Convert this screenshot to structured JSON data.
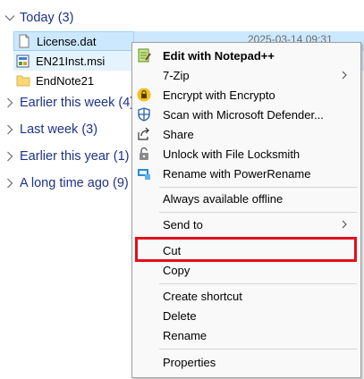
{
  "groups": {
    "today": "Today (3)",
    "earlier_this_week": "Earlier this week (4)",
    "last_week": "Last week (3)",
    "earlier_this_year": "Earlier this year (1)",
    "long_time_ago": "A long time ago (9)"
  },
  "files": [
    {
      "name": "License.dat",
      "icon": "document-icon"
    },
    {
      "name": "EN21Inst.msi",
      "icon": "installer-icon"
    },
    {
      "name": "EndNote21",
      "icon": "folder-icon"
    }
  ],
  "selected_date": "2025-03-14 09:31",
  "menu": {
    "edit_notepad": "Edit with Notepad++",
    "seven_zip": "7-Zip",
    "encrypt": "Encrypt with Encrypto",
    "scan": "Scan with Microsoft Defender...",
    "share": "Share",
    "unlock": "Unlock with File Locksmith",
    "rename_power": "Rename with PowerRename",
    "always_offline": "Always available offline",
    "send_to": "Send to",
    "cut": "Cut",
    "copy": "Copy",
    "create_shortcut": "Create shortcut",
    "delete": "Delete",
    "rename": "Rename",
    "properties": "Properties"
  },
  "colors": {
    "group_header": "#1e3287",
    "selection": "#cce8ff",
    "highlight_box": "#e2101b",
    "menu_bg": "#f9f9f9"
  }
}
